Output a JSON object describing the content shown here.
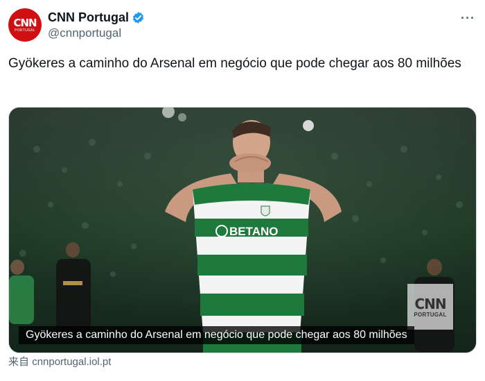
{
  "account": {
    "avatar_text": "CNN",
    "avatar_subtext": "PORTUGAL",
    "name": "CNN Portugal",
    "handle": "@cnnportugal",
    "verified": true
  },
  "menu": {
    "more_label": "···"
  },
  "tweet": {
    "text": "Gyökeres a caminho do Arsenal em negócio que pode chegar aos 80 milhões"
  },
  "media": {
    "caption": "Gyökeres a caminho do Arsenal em negócio que pode chegar aos 80 milhões",
    "watermark_logo": "CNN",
    "watermark_sub": "PORTUGAL",
    "shirt_sponsor": "BETANO"
  },
  "source": {
    "prefix": "来自",
    "domain": "cnnportugal.iol.pt"
  },
  "colors": {
    "brand_red": "#d00f12",
    "verified_blue": "#1d9bf0",
    "jersey_green": "#1e7a3c"
  }
}
